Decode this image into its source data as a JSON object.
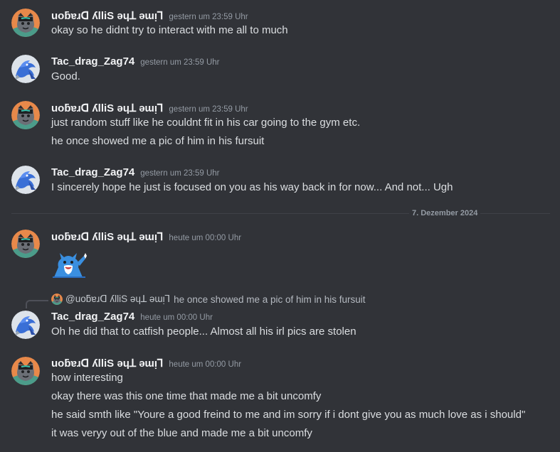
{
  "users": {
    "dragon": {
      "name": "uoƃɐɹᗡ ʎlliS ǝɥꓕ ǝɯᴉꓶ",
      "avatar_icon": "wolf-avatar-icon"
    },
    "tac": {
      "name": "Tac_drag_Zag74",
      "avatar_icon": "dragon-avatar-icon"
    }
  },
  "messages": [
    {
      "author": "uoƃɐɹᗡ ʎlliS ǝɥꓕ ǝɯᴉꓶ",
      "timestamp": "gestern um 23:59 Uhr",
      "lines": [
        "okay so he didnt try to interact with me all to much"
      ]
    },
    {
      "author": "Tac_drag_Zag74",
      "timestamp": "gestern um 23:59 Uhr",
      "lines": [
        "Good."
      ]
    },
    {
      "author": "uoƃɐɹᗡ ʎlliS ǝɥꓕ ǝɯᴉꓶ",
      "timestamp": "gestern um 23:59 Uhr",
      "lines": [
        "just random stuff like he couldnt fit in his car going to the gym etc.",
        "he once showed me a pic of him in his fursuit"
      ]
    },
    {
      "author": "Tac_drag_Zag74",
      "timestamp": "gestern um 23:59 Uhr",
      "lines": [
        "I sincerely hope he just is focused on you as his way back in for now... And not... Ugh"
      ]
    },
    {
      "author": "uoƃɐɹᗡ ʎlliS ǝɥꓕ ǝɯᴉꓶ",
      "timestamp": "heute um 00:00 Uhr",
      "lines": [],
      "sticker": "waving-blue-dragon-sticker"
    },
    {
      "author": "Tac_drag_Zag74",
      "timestamp": "heute um 00:00 Uhr",
      "reply": {
        "name": "@uoƃɐɹᗡ ʎlliS ǝɥꓕ ǝɯᴉꓶ",
        "text": "he once showed me a pic of him in his fursuit"
      },
      "lines": [
        "Oh he did that to catfish people... Almost all his irl pics are stolen"
      ]
    },
    {
      "author": "uoƃɐɹᗡ ʎlliS ǝɥꓕ ǝɯᴉꓶ",
      "timestamp": "heute um 00:00 Uhr",
      "lines": [
        "how interesting",
        "okay there was this one time that made me a bit uncomfy",
        "he said smth like \"Youre a good freind to me and im sorry if i dont give you as much love as i should\"",
        "it was veryy out of the blue and made me a bit uncomfy"
      ]
    }
  ],
  "date_divider": "7. Dezember 2024",
  "colors": {
    "background": "#313338",
    "username": "#f2f3f5",
    "message_text": "#dbdee1",
    "timestamp": "#949ba4",
    "divider": "#3f4147"
  }
}
